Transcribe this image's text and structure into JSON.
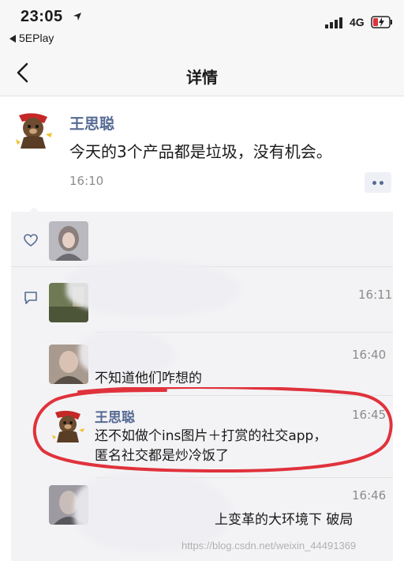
{
  "status_bar": {
    "time": "23:05",
    "back_app": "5EPlay",
    "network": "4G"
  },
  "nav": {
    "title": "详情"
  },
  "post": {
    "author": "王思聪",
    "text": "今天的3个产品都是垃圾，没有机会。",
    "time": "16:10"
  },
  "comments": [
    {
      "time": "16:11",
      "text": ""
    },
    {
      "time": "16:40",
      "text": "不知道他们咋想的"
    },
    {
      "name": "王思聪",
      "time": "16:45",
      "line1": "还不如做个ins图片＋打赏的社交app，",
      "line2": "匿名社交都是炒冷饭了"
    },
    {
      "time": "16:46",
      "text": "上变革的大环境下 破局"
    }
  ],
  "watermark": "https://blog.csdn.net/weixin_44491369",
  "colors": {
    "name_blue": "#566b94",
    "panel_bg": "#f3f3f5",
    "highlight_red": "#e0323c"
  },
  "icons": [
    "location-arrow-icon",
    "signal-icon",
    "battery-charging-icon",
    "back-chevron-icon",
    "more-dots-icon",
    "heart-icon",
    "comment-icon"
  ]
}
